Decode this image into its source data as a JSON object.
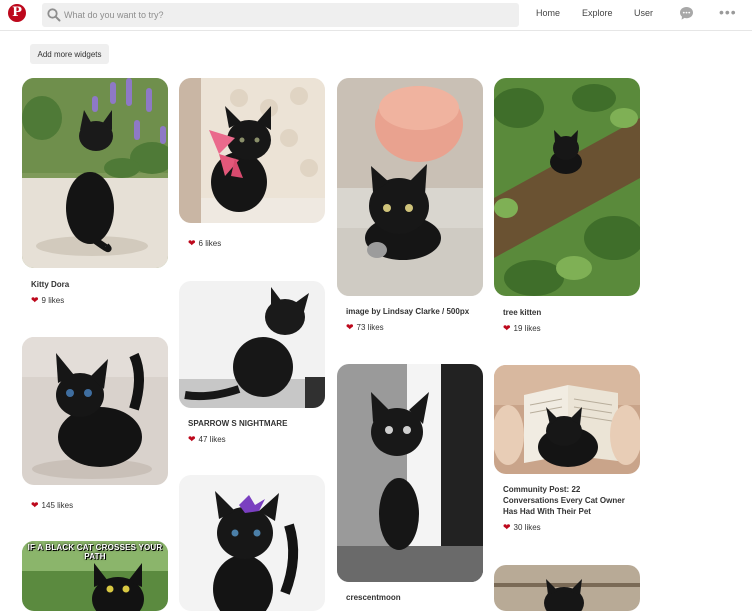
{
  "header": {
    "logo": "P",
    "search_placeholder": "What do you want to try?",
    "nav": [
      "Home",
      "Explore",
      "User"
    ],
    "more": "•••"
  },
  "toolbar": {
    "add_widgets_label": "Add more widgets"
  },
  "colors": {
    "brand": "#bd081c",
    "heart": "#bd081c",
    "search_bg": "#efefef"
  },
  "pins": [
    {
      "title": "Kitty Dora",
      "likes": "9 likes"
    },
    {
      "title": "",
      "likes": "145 likes"
    },
    {
      "banner": "IF A BLACK CAT CROSSES YOUR PATH"
    },
    {
      "likes": "6 likes"
    },
    {
      "title": "SPARROW S NIGHTMARE",
      "likes": "47 likes"
    },
    {
      "title": "image by Lindsay Clarke / 500px",
      "likes": "73 likes"
    },
    {
      "title": "crescentmoon"
    },
    {
      "title": "tree kitten",
      "likes": "19 likes"
    },
    {
      "title_lines": [
        "Community Post: 22",
        "Conversations Every Cat Owner",
        "Has Had With Their Pet"
      ],
      "likes": "30 likes"
    }
  ]
}
